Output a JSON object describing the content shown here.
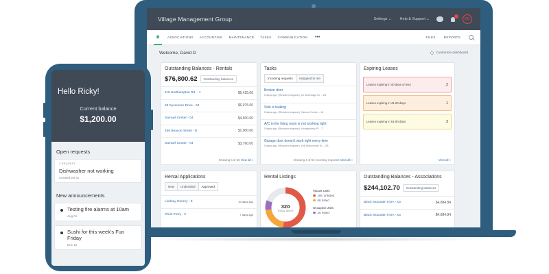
{
  "app": {
    "title": "Village Management Group",
    "settings_label": "Settings",
    "help_label": "Help & Support",
    "avatar_initials": "DD"
  },
  "nav": {
    "items": [
      "ASSOCIATIONS",
      "ACCOUNTING",
      "MAINTENANCE",
      "TASKS",
      "COMMUNICATION"
    ],
    "more": "•••",
    "right_items": [
      "FILES",
      "REPORTS"
    ]
  },
  "welcome": {
    "text": "Welcome, David D",
    "customize": "Customize dashboard"
  },
  "outstanding_rentals": {
    "title": "Outstanding Balances - Rentals",
    "total": "$76,800.62",
    "pill": "Outstanding balances",
    "rows": [
      {
        "name": "115 Northampton Rd. - 1",
        "amount": "$6,425.00"
      },
      {
        "name": "25 Sycamore Drive - 04",
        "amount": "$6,075.00"
      },
      {
        "name": "Samuel Center - 04",
        "amount": "$4,600.00"
      },
      {
        "name": "456 Beacon Street - B",
        "amount": "$1,000.00"
      },
      {
        "name": "Samuel Center - 04",
        "amount": "$3,760.00"
      }
    ],
    "footer_text": "Showing 5 of 56",
    "footer_link": "View all »"
  },
  "tasks": {
    "title": "Tasks",
    "tabs": [
      "Incoming requests",
      "Assigned to me"
    ],
    "rows": [
      {
        "title": "Broken door",
        "meta": "5 days ago | Resident request | 46 Sturbridge Dr. - 2B"
      },
      {
        "title": "Sink is leaking",
        "meta": "5 days ago | Resident request | Samuel Center - 14"
      },
      {
        "title": "A/C in the living room is not working right",
        "meta": "5 days ago | Resident request | Montgomery Pl. - 7"
      },
      {
        "title": "Garage door doesn't work right every time",
        "meta": "5 days ago | Resident request | 456 Winchester St. - 2B"
      }
    ],
    "footer_text": "Showing 4 of 56 incoming requests",
    "footer_link": "View all »"
  },
  "expiring_leases": {
    "title": "Expiring Leases",
    "rows": [
      {
        "label": "Leases expiring in 40 days or less",
        "count": "2",
        "bg": "#fdecec",
        "border": "#e9a3a3"
      },
      {
        "label": "Leases expiring in 41-60 days",
        "count": "1",
        "bg": "#fdeedd",
        "border": "#f0c08a"
      },
      {
        "label": "Leases expiring in 61-90 days",
        "count": "3",
        "bg": "#fefbe3",
        "border": "#ead98a"
      }
    ],
    "footer_link": "View all »"
  },
  "rental_applications": {
    "title": "Rental Applications",
    "tabs": [
      "New",
      "Undecided",
      "Approved"
    ],
    "rows": [
      {
        "name": "Lindsey Genrey - 5",
        "meta": "15 days ago"
      },
      {
        "name": "Chris Perry - 2",
        "meta": "7 days ago"
      }
    ]
  },
  "rental_listings": {
    "title": "Rental Listings",
    "total_units": "320",
    "total_label": "TOTAL UNITS",
    "vacant": {
      "label": "Vacant Units",
      "unlisted": "166",
      "unlisted_label": "unlisted",
      "listed": "68",
      "listed_label": "listed"
    },
    "occupied": {
      "label": "Occupied Units",
      "value": "25",
      "value_label": "listed"
    }
  },
  "chart_data": {
    "type": "pie",
    "title": "Rental Listings",
    "categories": [
      "Vacant unlisted",
      "Vacant listed",
      "Occupied listed",
      "Occupied"
    ],
    "values": [
      166,
      68,
      25,
      61
    ],
    "colors": [
      "#e05a47",
      "#f4a63c",
      "#9a6fc0",
      "#e7e9ec"
    ]
  },
  "outstanding_associations": {
    "title": "Outstanding Balances - Associations",
    "total": "$244,102.70",
    "pill": "Outstanding balances",
    "rows": [
      {
        "name": "Black Mountain HOA - 15",
        "amount": "$4,884.84"
      },
      {
        "name": "Black Mountain HOA - 15",
        "amount": "$4,884.84"
      }
    ]
  },
  "phone": {
    "greeting": "Hello Ricky!",
    "balance_label": "Current balance",
    "balance": "$1,200.00",
    "open_requests_title": "Open requests",
    "request": {
      "code": "3 REQUEST",
      "title": "Dishwasher not working",
      "date": "Created Jul 31"
    },
    "announcements_title": "New announcements",
    "announcements": [
      {
        "title": "Testing fire alarms at 10am",
        "date": "Aug 01"
      },
      {
        "title": "Sushi for this week's Fun Friday",
        "date": "Dec 10"
      }
    ]
  }
}
